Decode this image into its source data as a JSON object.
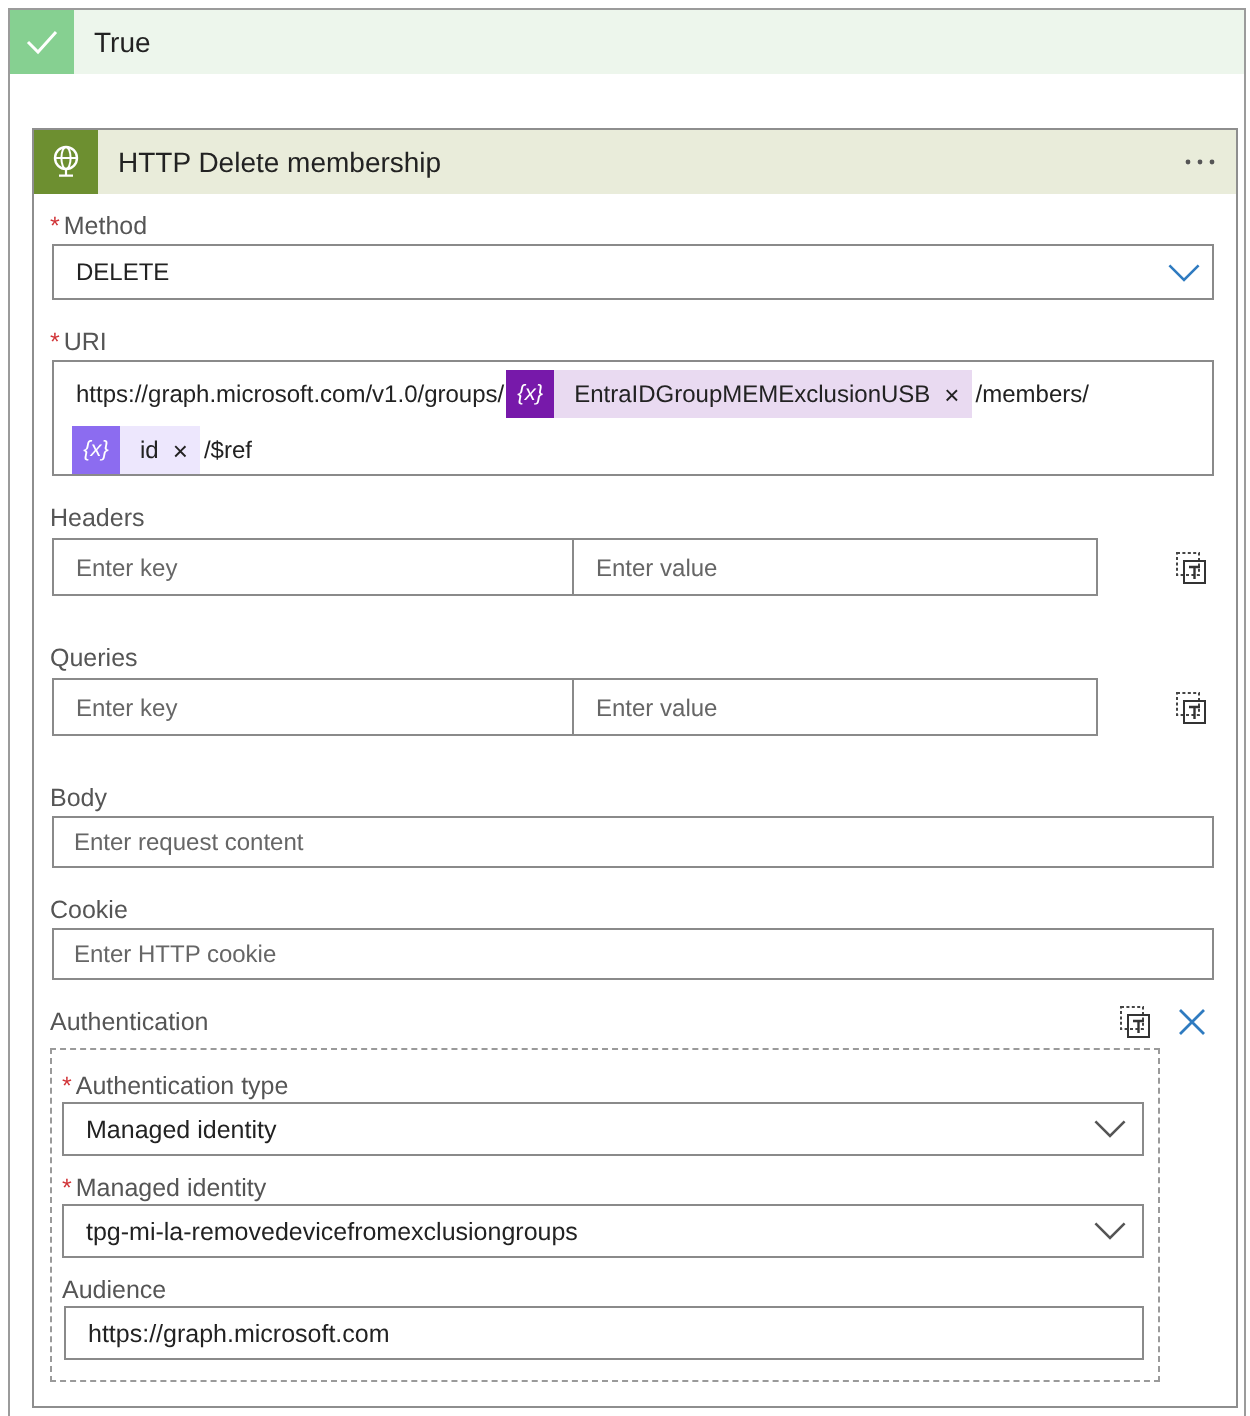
{
  "branch": {
    "label": "True"
  },
  "action": {
    "title": "HTTP Delete membership",
    "fields": [
      {
        "kind": "select",
        "label": "Method",
        "required_mark": "*",
        "value": "DELETE",
        "focused": true
      },
      {
        "kind": "tokens",
        "label": "URI",
        "required_mark": "*",
        "lines": [
          [
            {
              "kind": "text",
              "text": "https://graph.microsoft.com/v1.0/groups/"
            },
            {
              "kind": "token",
              "icon": "{x}",
              "text": "EntraIDGroupMEMExclusionUSB",
              "remove": "×",
              "color": "#7719aa"
            },
            {
              "kind": "text",
              "text": "/members/"
            }
          ],
          [
            {
              "kind": "token",
              "icon": "{x}",
              "text": "id",
              "remove": "×",
              "color": "#8c6cf0"
            },
            {
              "kind": "text",
              "text": "/$ref"
            }
          ]
        ]
      },
      {
        "kind": "keyvalue",
        "label": "Headers",
        "key_placeholder": "Enter key",
        "value_placeholder": "Enter value"
      },
      {
        "kind": "keyvalue",
        "label": "Queries",
        "key_placeholder": "Enter key",
        "value_placeholder": "Enter value"
      },
      {
        "kind": "text",
        "label": "Body",
        "placeholder": "Enter request content"
      },
      {
        "kind": "text",
        "label": "Cookie",
        "placeholder": "Enter HTTP cookie"
      },
      {
        "kind": "group",
        "label": "Authentication",
        "fields": [
          {
            "kind": "select",
            "label": "Authentication type",
            "required_mark": "*",
            "value": "Managed identity",
            "focused": false
          },
          {
            "kind": "select",
            "label": "Managed identity",
            "required_mark": "*",
            "value": "tpg-mi-la-removedevicefromexclusiongroups",
            "focused": false
          },
          {
            "kind": "text",
            "label": "Audience",
            "value": "https://graph.microsoft.com"
          }
        ]
      }
    ]
  }
}
